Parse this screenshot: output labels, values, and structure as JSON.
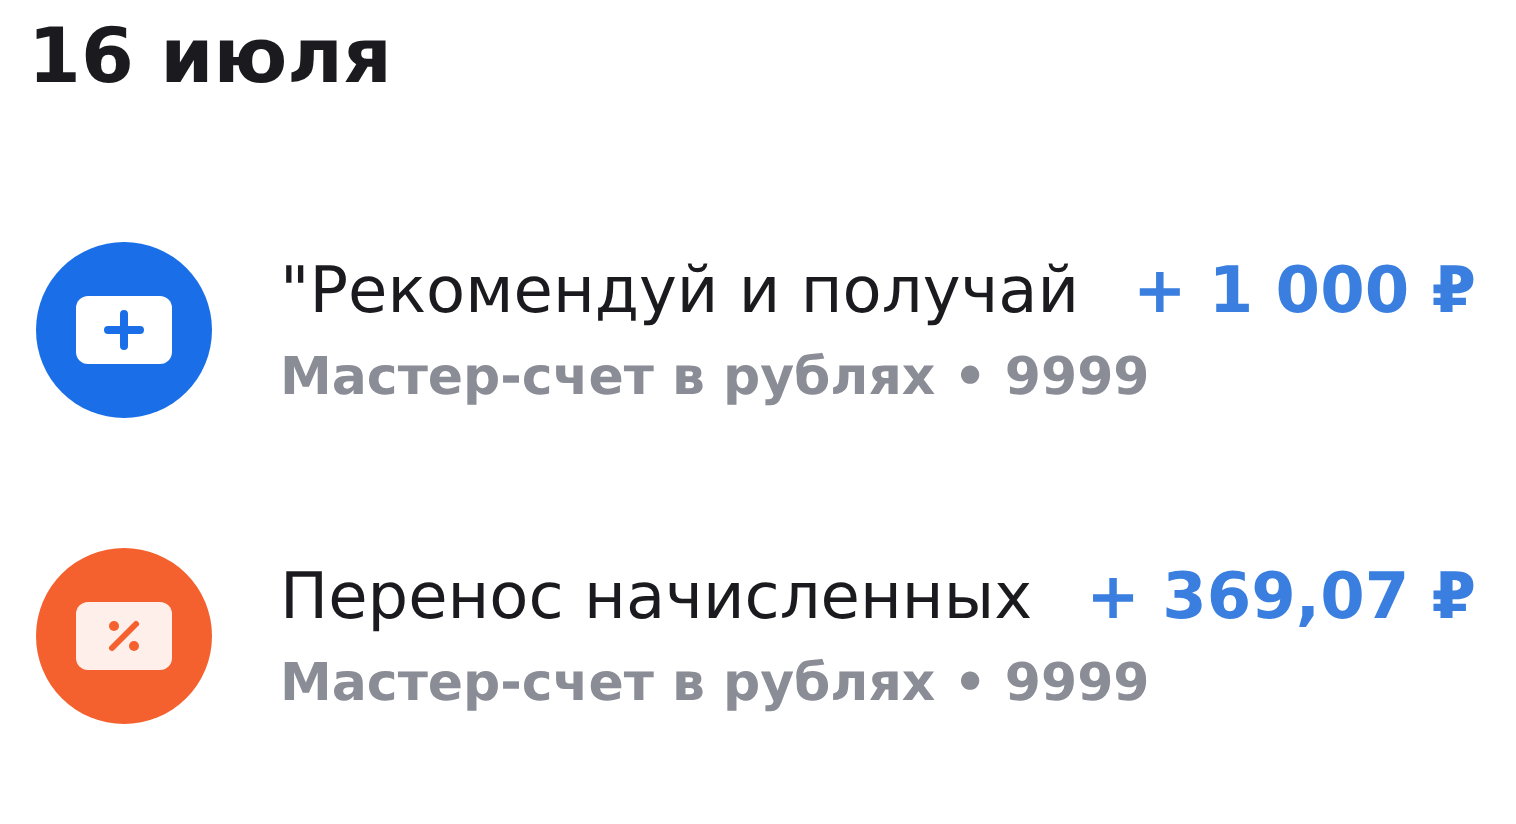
{
  "date_heading": "16 июля",
  "transactions": [
    {
      "kind": "card-plus",
      "color": "#1a6fe8",
      "title": "\"Рекомендуй и получай",
      "account": "Мастер-счет в рублях • 9999",
      "amount": "+ 1 000 ₽"
    },
    {
      "kind": "percent",
      "color": "#f4612f",
      "title": "Перенос начисленных",
      "account": "Мастер-счет в рублях • 9999",
      "amount": "+ 369,07 ₽"
    }
  ]
}
